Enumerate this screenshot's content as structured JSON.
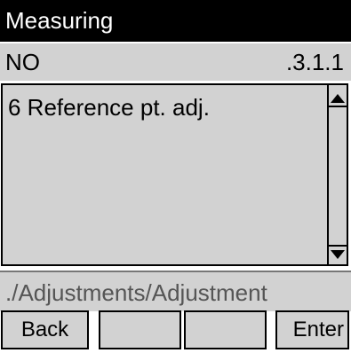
{
  "window": {
    "title": "Measuring"
  },
  "subheader": {
    "label": "NO",
    "code": ".3.1.1"
  },
  "list": {
    "items": [
      {
        "label": "6 Reference pt. adj."
      }
    ]
  },
  "path": {
    "text": "./Adjustments/Adjustment"
  },
  "softkeys": {
    "back_label": "Back",
    "f2_label": "",
    "f3_label": "",
    "enter_label": "Enter"
  },
  "colors": {
    "title_bg": "#000000",
    "panel_bg": "#d2d2d2",
    "path_text": "#555555"
  },
  "icons": {
    "scroll_up": "scroll-up-arrow-icon",
    "scroll_down": "scroll-down-arrow-icon"
  }
}
